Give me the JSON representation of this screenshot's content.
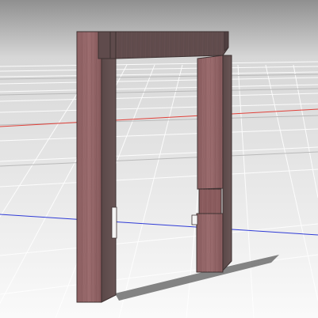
{
  "viewport": {
    "kind": "3d-modeling-viewport",
    "background_top": "#9a9a9a",
    "background_bottom": "#f7f7f7",
    "grid_color": "#ffffff",
    "grid_major_color": "#cfcfcf",
    "x_axis_color": "#e0413a",
    "y_axis_color": "#2f3bd6"
  },
  "model": {
    "name": "",
    "wood_color": "#8a5c5c",
    "wood_dark": "#5e4747",
    "shadow_color": "#6f6f6f",
    "parts": [
      "left-post",
      "top-beam",
      "right-post",
      "right-post-lower-block"
    ]
  }
}
